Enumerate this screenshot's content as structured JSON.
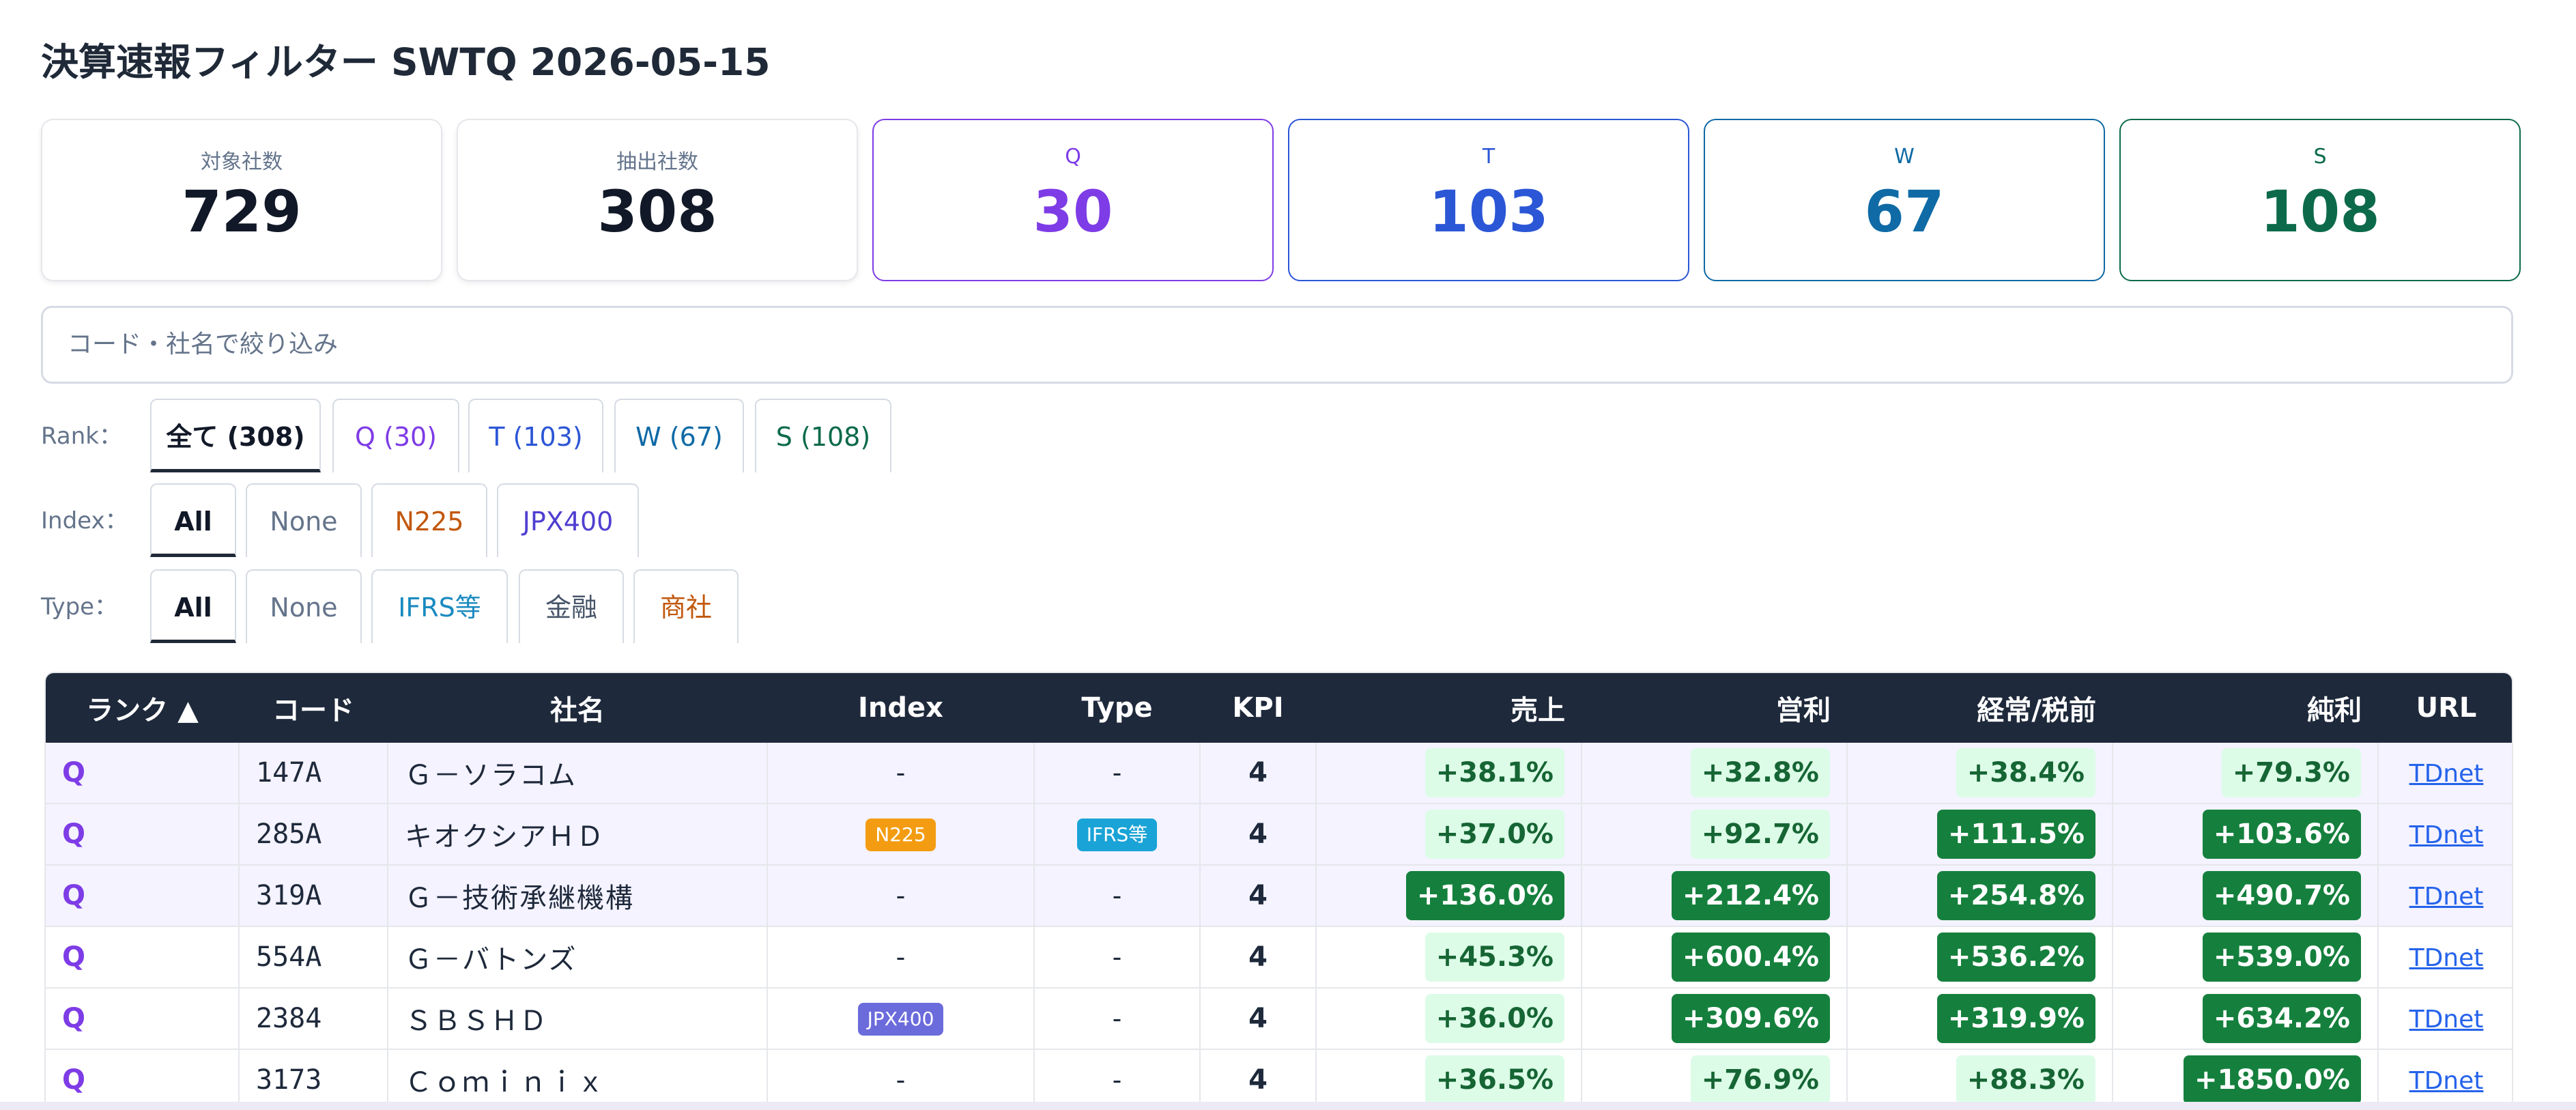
{
  "title": "決算速報フィルター SWTQ 2026-05-15",
  "colors": {
    "Q": "#7e3ce6",
    "T": "#2b56d6",
    "W": "#0f6aa6",
    "S": "#0c6a4b",
    "N225": "#f39c12",
    "IFRS": "#1aa3d6",
    "JPX400": "#6b6bdc",
    "shoji": "#c2570c"
  },
  "cards": [
    {
      "label": "対象社数",
      "value": "729"
    },
    {
      "label": "抽出社数",
      "value": "308"
    },
    {
      "label": "Q",
      "value": "30"
    },
    {
      "label": "T",
      "value": "103"
    },
    {
      "label": "W",
      "value": "67"
    },
    {
      "label": "S",
      "value": "108"
    }
  ],
  "search": {
    "placeholder": "コード・社名で絞り込み"
  },
  "filters": {
    "rank": {
      "label": "Rank：",
      "options": [
        "全て (308)",
        "Q (30)",
        "T (103)",
        "W (67)",
        "S (108)"
      ]
    },
    "index": {
      "label": "Index：",
      "options": [
        "All",
        "None",
        "N225",
        "JPX400"
      ]
    },
    "type": {
      "label": "Type：",
      "options": [
        "All",
        "None",
        "IFRS等",
        "金融",
        "商社"
      ]
    }
  },
  "table": {
    "headers": [
      "ランク ▲",
      "コード",
      "社名",
      "Index",
      "Type",
      "KPI",
      "売上",
      "営利",
      "経常/税前",
      "純利",
      "URL"
    ],
    "rows": [
      {
        "rank": "Q",
        "code": "147A",
        "name": "Ｇ－ソラコム",
        "index": "-",
        "type": "-",
        "kpi": "4",
        "sales": "+38.1%",
        "op": "+32.8%",
        "ord": "+38.4%",
        "net": "+79.3%",
        "url": "TDnet"
      },
      {
        "rank": "Q",
        "code": "285A",
        "name": "キオクシアＨＤ",
        "index": "N225",
        "type": "IFRS等",
        "kpi": "4",
        "sales": "+37.0%",
        "op": "+92.7%",
        "ord": "+111.5%",
        "net": "+103.6%",
        "url": "TDnet"
      },
      {
        "rank": "Q",
        "code": "319A",
        "name": "Ｇ－技術承継機構",
        "index": "-",
        "type": "-",
        "kpi": "4",
        "sales": "+136.0%",
        "op": "+212.4%",
        "ord": "+254.8%",
        "net": "+490.7%",
        "url": "TDnet"
      },
      {
        "rank": "Q",
        "code": "554A",
        "name": "Ｇ－バトンズ",
        "index": "-",
        "type": "-",
        "kpi": "4",
        "sales": "+45.3%",
        "op": "+600.4%",
        "ord": "+536.2%",
        "net": "+539.0%",
        "url": "TDnet"
      },
      {
        "rank": "Q",
        "code": "2384",
        "name": "ＳＢＳＨＤ",
        "index": "JPX400",
        "type": "-",
        "kpi": "4",
        "sales": "+36.0%",
        "op": "+309.6%",
        "ord": "+319.9%",
        "net": "+634.2%",
        "url": "TDnet"
      },
      {
        "rank": "Q",
        "code": "3173",
        "name": "Ｃｏｍｉｎｉｘ",
        "index": "-",
        "type": "-",
        "kpi": "4",
        "sales": "+36.5%",
        "op": "+76.9%",
        "ord": "+88.3%",
        "net": "+1850.0%",
        "url": "TDnet"
      }
    ]
  }
}
